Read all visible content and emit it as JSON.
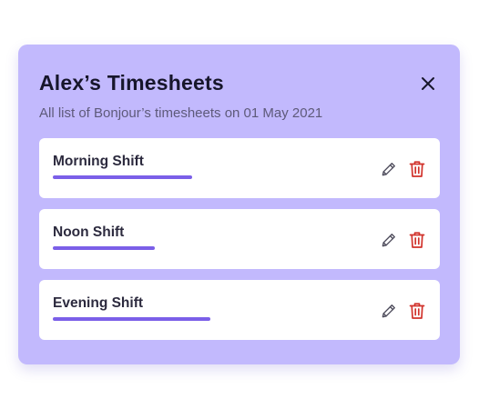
{
  "modal": {
    "title": "Alex’s Timesheets",
    "subtitle": "All list of Bonjour’s timesheets on 01 May 2021",
    "close_icon": "close-icon"
  },
  "shifts": [
    {
      "label": "Morning Shift",
      "progress": 0.85,
      "edit_icon": "pencil-icon",
      "delete_icon": "trash-icon"
    },
    {
      "label": "Noon Shift",
      "progress": 0.62,
      "edit_icon": "pencil-icon",
      "delete_icon": "trash-icon"
    },
    {
      "label": "Evening Shift",
      "progress": 0.96,
      "edit_icon": "pencil-icon",
      "delete_icon": "trash-icon"
    }
  ],
  "colors": {
    "modal_background": "#c2b9fd",
    "card_background": "#ffffff",
    "progress": "#7b5fe8",
    "delete": "#d1322b",
    "edit": "#4a4858"
  }
}
